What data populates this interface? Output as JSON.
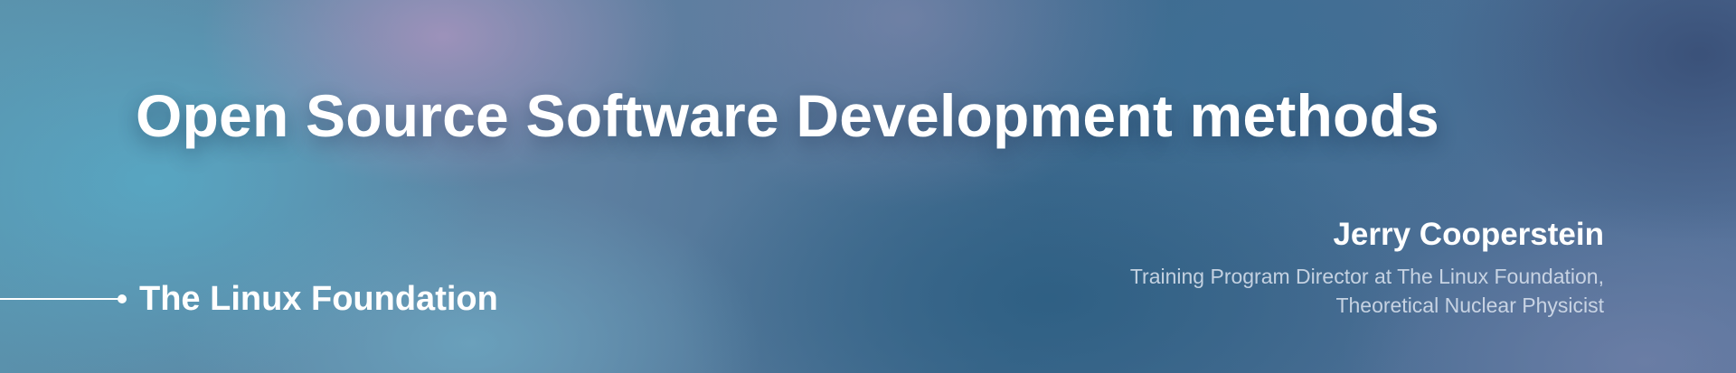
{
  "banner": {
    "title": "Open Source Software Development methods",
    "organization": "The Linux Foundation",
    "speaker": {
      "name": "Jerry Cooperstein",
      "role_line1": "Training Program Director at The Linux Foundation,",
      "role_line2": "Theoretical Nuclear Physicist"
    }
  },
  "colors": {
    "text": "#ffffff",
    "role_text": "#dce4f0",
    "background_primary": "#4f7590",
    "background_lavender": "#a894be",
    "background_teal": "#58a8c4",
    "background_deep_blue": "#2c5e82"
  }
}
